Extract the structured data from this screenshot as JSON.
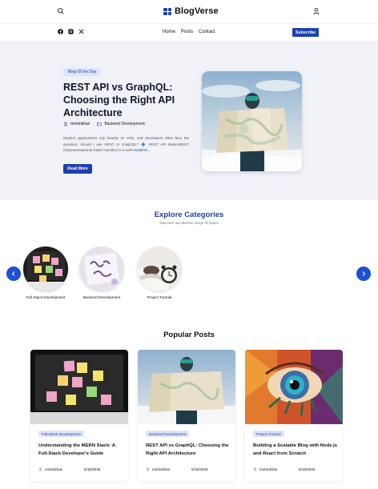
{
  "header": {
    "brand": "BlogVerse",
    "icons": [
      "search-icon",
      "grid-logo-icon",
      "user-icon"
    ]
  },
  "nav": {
    "social": [
      "facebook-icon",
      "instagram-icon",
      "x-icon"
    ],
    "links": [
      "Home",
      "Posts",
      "Contact"
    ],
    "subscribe_label": "Subscribe"
  },
  "hero": {
    "badge": "Blog Of the Day",
    "title": "REST API vs GraphQL: Choosing the Right API Architecture",
    "author": "mohinkhan",
    "category": "Backend Development",
    "excerpt": "Modern applications rely heavily on APIs, and developers often face the question: should I use REST or GraphQL? 🔷 REST API BasicsREST (Representational State Transfer) is a well-establish...",
    "read_more_label": "Read More"
  },
  "categories": {
    "title": "Explore Categories",
    "subtitle": "Discover our diverse range of topics",
    "items": [
      {
        "label": "Full-Stack Development"
      },
      {
        "label": "Backend Development"
      },
      {
        "label": "Project Tutorial"
      }
    ]
  },
  "popular": {
    "title": "Popular Posts",
    "posts": [
      {
        "tag": "Full-Stack Development",
        "title": "Understanding the MERN Stack: A Full-Stack Developer's Guide",
        "author": "mohinkhan",
        "date": "5/18/2025"
      },
      {
        "tag": "Backend Development",
        "title": "REST API vs GraphQL: Choosing the Right API Architecture",
        "author": "mohinkhan",
        "date": "5/18/2025"
      },
      {
        "tag": "Project Tutorial",
        "title": "Building a Scalable Blog with Node.js and React from Scratch",
        "author": "mohinkhan",
        "date": "5/18/2025"
      }
    ]
  },
  "colors": {
    "brand": "#1e3fae",
    "accent": "#1d4ed8",
    "hero_bg": "#f1f1f8",
    "badge_bg": "#dde3fb"
  }
}
